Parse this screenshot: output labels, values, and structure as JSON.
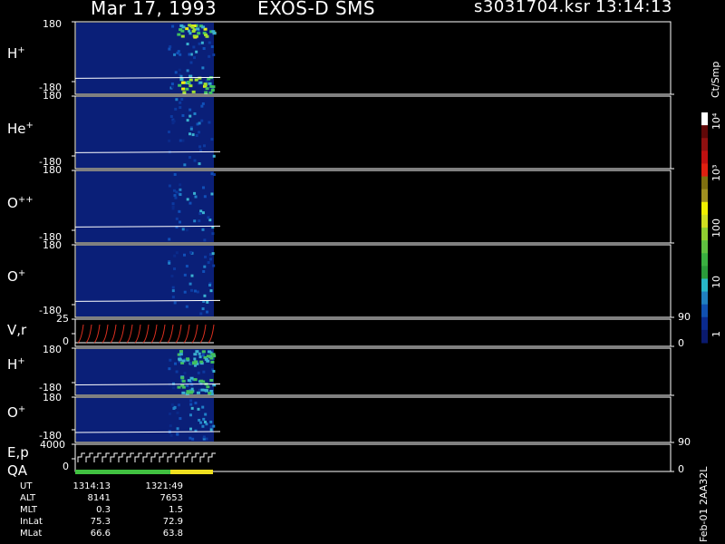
{
  "header": {
    "date": "Mar 17, 1993",
    "instrument": "EXOS-D SMS",
    "file": "s3031704.ksr",
    "time": "13:14:13"
  },
  "panels": [
    {
      "label_main": "H",
      "label_sup": "+",
      "top_tick": "180",
      "bottom_tick": "-180"
    },
    {
      "label_main": "He",
      "label_sup": "+",
      "top_tick": "180",
      "bottom_tick": "-180"
    },
    {
      "label_main": "O",
      "label_sup": "++",
      "top_tick": "180",
      "bottom_tick": "-180"
    },
    {
      "label_main": "O",
      "label_sup": "+",
      "top_tick": "180",
      "bottom_tick": "-180"
    },
    {
      "label_main": "V,r",
      "label_sup": "",
      "top_tick": "25",
      "bottom_tick": "0",
      "right_top": "90",
      "right_bottom": "0"
    },
    {
      "label_main": "H",
      "label_sup": "+",
      "top_tick": "180",
      "bottom_tick": "-180"
    },
    {
      "label_main": "O",
      "label_sup": "+",
      "top_tick": "180",
      "bottom_tick": "-180"
    },
    {
      "label_main": "E,p",
      "label_sup": "",
      "top_tick": "4000",
      "bottom_tick": "0",
      "right_top": "90",
      "right_bottom": "0"
    }
  ],
  "qa_label": "QA",
  "orbit_table": {
    "rows": [
      {
        "key": "UT",
        "v1": "1314:13",
        "v2": "1321:49"
      },
      {
        "key": "ALT",
        "v1": "8141",
        "v2": "7653"
      },
      {
        "key": "MLT",
        "v1": "0.3",
        "v2": "1.5"
      },
      {
        "key": "InLat",
        "v1": "75.3",
        "v2": "72.9"
      },
      {
        "key": "MLat",
        "v1": "66.6",
        "v2": "63.8"
      }
    ]
  },
  "colorbar": {
    "unit": "Ct/Smp",
    "labels": [
      "1",
      "10",
      "100",
      "10³",
      "10⁴"
    ],
    "colors": [
      "#0a1a6e",
      "#0a2a8e",
      "#1050b0",
      "#2080c0",
      "#28b8c8",
      "#2a9a3a",
      "#3ab040",
      "#60c040",
      "#90d030",
      "#d0e020",
      "#f0f000",
      "#a09020",
      "#807010",
      "#e02010",
      "#c01010",
      "#901010",
      "#600808",
      "#ffffff"
    ]
  },
  "footer_tag": "Feb-01 2AA32L",
  "chart_data": {
    "type": "heatmap",
    "title": "Mar 17, 1993   EXOS-D SMS",
    "panels": [
      "H+",
      "He+",
      "O++",
      "O+",
      "V,r",
      "H+",
      "O+",
      "E,p"
    ],
    "ylim_angle": [
      -180,
      180
    ],
    "ylim_vr": [
      0,
      25
    ],
    "ylim_ep": [
      0,
      4000
    ],
    "colorbar_range": [
      1,
      10000
    ],
    "colorbar_scale": "log",
    "time_range": [
      "1314:13",
      "1321:49"
    ]
  }
}
